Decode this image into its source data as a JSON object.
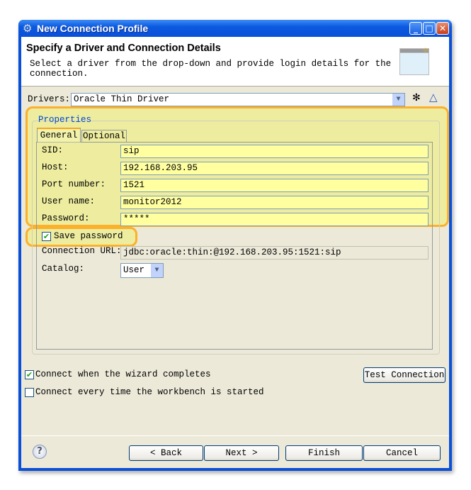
{
  "window": {
    "title": "New Connection Profile",
    "minimize": "_",
    "maximize": "□",
    "close": "✕"
  },
  "header": {
    "title": "Specify a Driver and Connection Details",
    "description": "Select a driver from the drop-down and provide login details for the connection."
  },
  "drivers": {
    "label": "Drivers:",
    "value": "Oracle Thin Driver"
  },
  "properties": {
    "group_label": "Properties",
    "tabs": [
      {
        "label": "General",
        "active": true
      },
      {
        "label": "Optional",
        "active": false
      }
    ],
    "fields": [
      {
        "label": "SID:",
        "value": "sip"
      },
      {
        "label": "Host:",
        "value": "192.168.203.95"
      },
      {
        "label": "Port number:",
        "value": "1521"
      },
      {
        "label": "User name:",
        "value": "monitor2012"
      },
      {
        "label": "Password:",
        "value": "*****"
      }
    ],
    "save_password": {
      "label": "Save password",
      "checked": true
    },
    "connection_url": {
      "label": "Connection URL:",
      "value": "jdbc:oracle:thin:@192.168.203.95:1521:sip"
    },
    "catalog": {
      "label": "Catalog:",
      "value": "User"
    }
  },
  "options": {
    "connect_on_finish": {
      "label": "Connect when the wizard completes",
      "checked": true
    },
    "connect_on_startup": {
      "label": "Connect every time the workbench is started",
      "checked": false
    },
    "test_connection": "Test Connection"
  },
  "footer": {
    "back": "< Back",
    "next": "Next >",
    "finish": "Finish",
    "cancel": "Cancel"
  },
  "colors": {
    "highlight": "#fbb12b",
    "title_bar": "#0a4fd8",
    "field_bg": "#ffffa0"
  }
}
